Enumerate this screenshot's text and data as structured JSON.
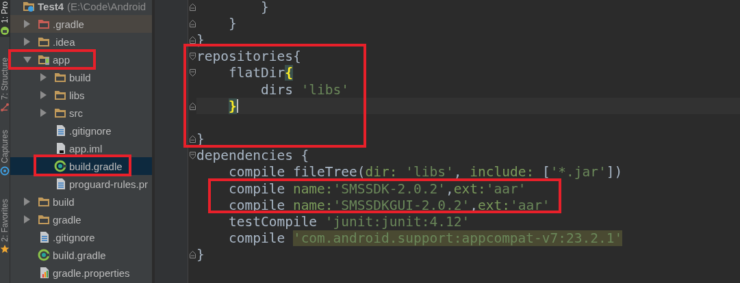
{
  "tool_strip": [
    {
      "label": "1: Pro",
      "selected": true,
      "kind": "android"
    },
    {
      "label": "7: Structure",
      "selected": false,
      "kind": "structure"
    },
    {
      "label": "Captures",
      "selected": false,
      "kind": "capture"
    },
    {
      "label": "2: Favorites",
      "selected": false,
      "kind": "star"
    }
  ],
  "project_tree": {
    "root": {
      "name": "Test4",
      "path": "(E:\\Code\\Android",
      "kind": "project",
      "children": [
        {
          "label": ".gradle",
          "kind": "folder-excluded",
          "expanded": false,
          "selected": false,
          "hovered": true
        },
        {
          "label": ".idea",
          "kind": "folder",
          "expanded": false,
          "selected": false,
          "hovered": false
        },
        {
          "label": "app",
          "kind": "module",
          "expanded": true,
          "selected": false,
          "hovered": false,
          "children": [
            {
              "label": "build",
              "kind": "folder",
              "expanded": false,
              "selected": false,
              "hovered": false
            },
            {
              "label": "libs",
              "kind": "folder",
              "expanded": false,
              "selected": false,
              "hovered": false
            },
            {
              "label": "src",
              "kind": "folder",
              "expanded": false,
              "selected": false,
              "hovered": false
            },
            {
              "label": ".gitignore",
              "kind": "text-file",
              "selected": false,
              "hovered": false
            },
            {
              "label": "app.iml",
              "kind": "iml-file",
              "selected": false,
              "hovered": false
            },
            {
              "label": "build.gradle",
              "kind": "gradle-file",
              "selected": true,
              "hovered": false
            },
            {
              "label": "proguard-rules.pr",
              "kind": "text-file",
              "selected": false,
              "hovered": false
            }
          ]
        },
        {
          "label": "build",
          "kind": "folder",
          "expanded": false,
          "selected": false,
          "hovered": false
        },
        {
          "label": "gradle",
          "kind": "folder",
          "expanded": false,
          "selected": false,
          "hovered": false
        },
        {
          "label": ".gitignore",
          "kind": "text-file",
          "selected": false,
          "hovered": false
        },
        {
          "label": "build.gradle",
          "kind": "gradle-file",
          "selected": false,
          "hovered": false
        },
        {
          "label": "gradle.properties",
          "kind": "properties-file",
          "selected": false,
          "hovered": false
        }
      ]
    }
  },
  "editor": {
    "lines": [
      {
        "current": false,
        "fold": {
          "kind": "close"
        },
        "segments": [
          {
            "kind": "plain",
            "text": "        }"
          }
        ]
      },
      {
        "current": false,
        "fold": {
          "kind": "close"
        },
        "segments": [
          {
            "kind": "plain",
            "text": "    }"
          }
        ]
      },
      {
        "current": false,
        "fold": {
          "kind": "close"
        },
        "segments": [
          {
            "kind": "plain",
            "text": "}"
          }
        ]
      },
      {
        "current": false,
        "fold": {
          "kind": "open"
        },
        "segments": [
          {
            "kind": "plain",
            "text": "repositories{"
          }
        ]
      },
      {
        "current": false,
        "fold": {
          "kind": "open"
        },
        "segments": [
          {
            "kind": "plain",
            "text": "    flatDir"
          },
          {
            "kind": "brace-match",
            "text": "{"
          }
        ]
      },
      {
        "current": false,
        "segments": [
          {
            "kind": "plain",
            "text": "        dirs "
          },
          {
            "kind": "string",
            "text": "'libs'"
          }
        ]
      },
      {
        "current": true,
        "fold": {
          "kind": "close"
        },
        "segments": [
          {
            "kind": "brace-match",
            "text": "    }"
          }
        ]
      },
      {
        "current": false
      },
      {
        "current": false,
        "fold": {
          "kind": "close"
        },
        "segments": [
          {
            "kind": "plain",
            "text": "}"
          }
        ]
      },
      {
        "current": false,
        "fold": {
          "kind": "open"
        },
        "segments": [
          {
            "kind": "plain",
            "text": "dependencies {"
          }
        ]
      },
      {
        "current": false,
        "segments": [
          {
            "kind": "plain",
            "text": "    compile fileTree("
          },
          {
            "kind": "label",
            "text": "dir: "
          },
          {
            "kind": "string",
            "text": "'libs'"
          },
          {
            "kind": "plain",
            "text": ", "
          },
          {
            "kind": "label",
            "text": "include: "
          },
          {
            "kind": "plain",
            "text": "["
          },
          {
            "kind": "string",
            "text": "'*.jar'"
          },
          {
            "kind": "plain",
            "text": "])"
          }
        ]
      },
      {
        "current": false,
        "segments": [
          {
            "kind": "plain",
            "text": "    compile "
          },
          {
            "kind": "label",
            "text": "name:"
          },
          {
            "kind": "string",
            "text": "'SMSSDK-2.0.2'"
          },
          {
            "kind": "plain",
            "text": ","
          },
          {
            "kind": "label",
            "text": "ext:"
          },
          {
            "kind": "string",
            "text": "'aar'"
          }
        ]
      },
      {
        "current": false,
        "segments": [
          {
            "kind": "plain",
            "text": "    compile "
          },
          {
            "kind": "label",
            "text": "name:"
          },
          {
            "kind": "string",
            "text": "'SMSSDKGUI-2.0.2'"
          },
          {
            "kind": "plain",
            "text": ","
          },
          {
            "kind": "label",
            "text": "ext:"
          },
          {
            "kind": "string",
            "text": "'aar'"
          }
        ]
      },
      {
        "current": false,
        "segments": [
          {
            "kind": "plain",
            "text": "    testCompile "
          },
          {
            "kind": "string",
            "text": "'junit:junit:4.12'"
          }
        ]
      },
      {
        "current": false,
        "segments": [
          {
            "kind": "plain",
            "text": "    compile "
          },
          {
            "kind": "string-highlight",
            "text": "'com.android.support:appcompat-v7:23.2.1'"
          }
        ]
      },
      {
        "current": false,
        "fold": {
          "kind": "close"
        },
        "segments": [
          {
            "kind": "plain",
            "text": "}"
          }
        ]
      }
    ]
  },
  "annotation_boxes": [
    {
      "kind": "rectangle",
      "color": "#e8202a"
    },
    {
      "kind": "rectangle",
      "color": "#e8202a"
    },
    {
      "kind": "rectangle",
      "color": "#e8202a"
    },
    {
      "kind": "rectangle",
      "color": "#e8202a"
    }
  ]
}
